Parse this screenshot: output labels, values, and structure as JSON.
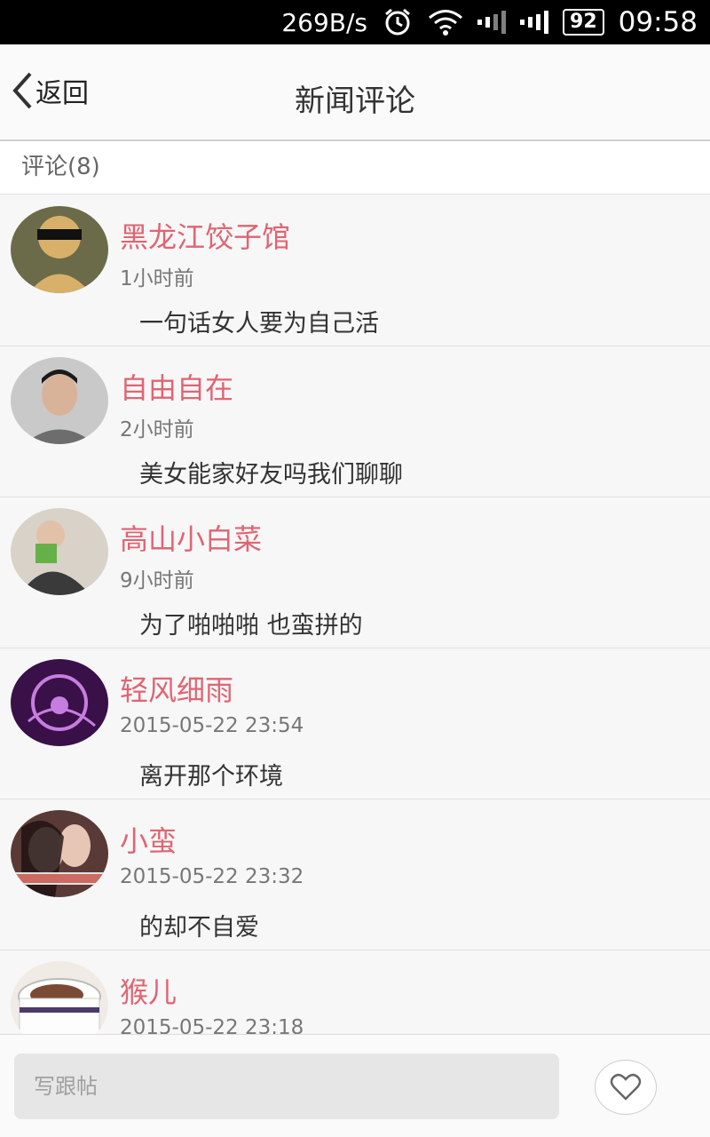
{
  "status_bar": {
    "speed": "269B/s",
    "battery": "92",
    "time": "09:58",
    "icons": [
      "alarm-icon",
      "wifi-icon",
      "signal-icon",
      "signal-icon"
    ]
  },
  "header": {
    "back_label": "返回",
    "title": "新闻评论"
  },
  "comments_header": {
    "label": "评论(8)"
  },
  "comments": [
    {
      "name": "黑龙江饺子馆",
      "time": "1小时前",
      "content": "一句话女人要为自己活",
      "avatar": {
        "bg": "#6b6b4a",
        "accent": "#d8b06a"
      }
    },
    {
      "name": "自由自在",
      "time": "2小时前",
      "content": "美女能家好友吗我们聊聊",
      "avatar": {
        "bg": "#c9c9c9",
        "accent": "#d9b29a"
      }
    },
    {
      "name": "高山小白菜",
      "time": "9小时前",
      "content": "为了啪啪啪 也蛮拼的",
      "avatar": {
        "bg": "#d9d2c9",
        "accent": "#3a3a3a"
      }
    },
    {
      "name": "轻风细雨",
      "time": "2015-05-22 23:54",
      "content": "离开那个环境",
      "avatar": {
        "bg": "#3a1048",
        "accent": "#c77de0"
      }
    },
    {
      "name": "小蛮",
      "time": "2015-05-22 23:32",
      "content": "的却不自爱",
      "avatar": {
        "bg": "#5a3a36",
        "accent": "#e0b9a8"
      }
    },
    {
      "name": "猴儿",
      "time": "2015-05-22 23:18",
      "content": "",
      "avatar": {
        "bg": "#f1ebe6",
        "accent": "#7b4a35"
      }
    }
  ],
  "footer": {
    "reply_placeholder": "写跟帖"
  },
  "colors": {
    "username": "#e06473",
    "background": "#f5f5f5"
  }
}
